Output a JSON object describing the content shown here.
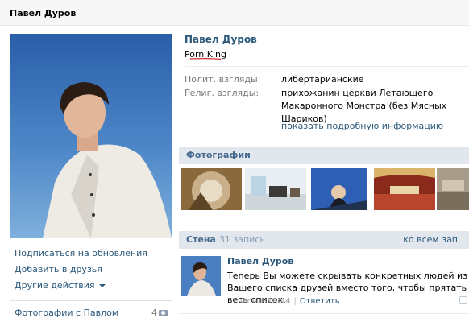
{
  "header": {
    "title": "Павел Дуров"
  },
  "profile": {
    "name": "Павел Дуров",
    "status": "Porn King",
    "info": [
      {
        "label": "Полит. взгляды:",
        "value": "либертарианские"
      },
      {
        "label": "Религ. взгляды:",
        "value": "прихожанин церкви Летающего Макаронного Монстра (без Мясных Шариков)"
      }
    ],
    "more_info": "показать подробную информацию"
  },
  "left_actions": {
    "subscribe": "Подписаться на обновления",
    "add_friend": "Добавить в друзья",
    "other": "Другие действия"
  },
  "photos_with": {
    "label": "Фотографии с Павлом",
    "count": "4"
  },
  "photos_section": {
    "title": "Фотографии"
  },
  "wall": {
    "title": "Стена",
    "count": "31 запись",
    "to_all": "ко всем зап",
    "post": {
      "author": "Павел Дуров",
      "text": "Теперь Вы можете скрывать конкретных людей из Вашего списка друзей вместо того, чтобы прятать весь список.",
      "date": "11 июн в 18:44",
      "reply": "Ответить"
    }
  },
  "colors": {
    "link": "#2b587a",
    "section_bg": "#e1e7ed",
    "status_underline": "#c00000"
  },
  "icons": {
    "dropdown": "chevron-down-icon",
    "camera": "camera-icon",
    "close": "close-icon"
  }
}
